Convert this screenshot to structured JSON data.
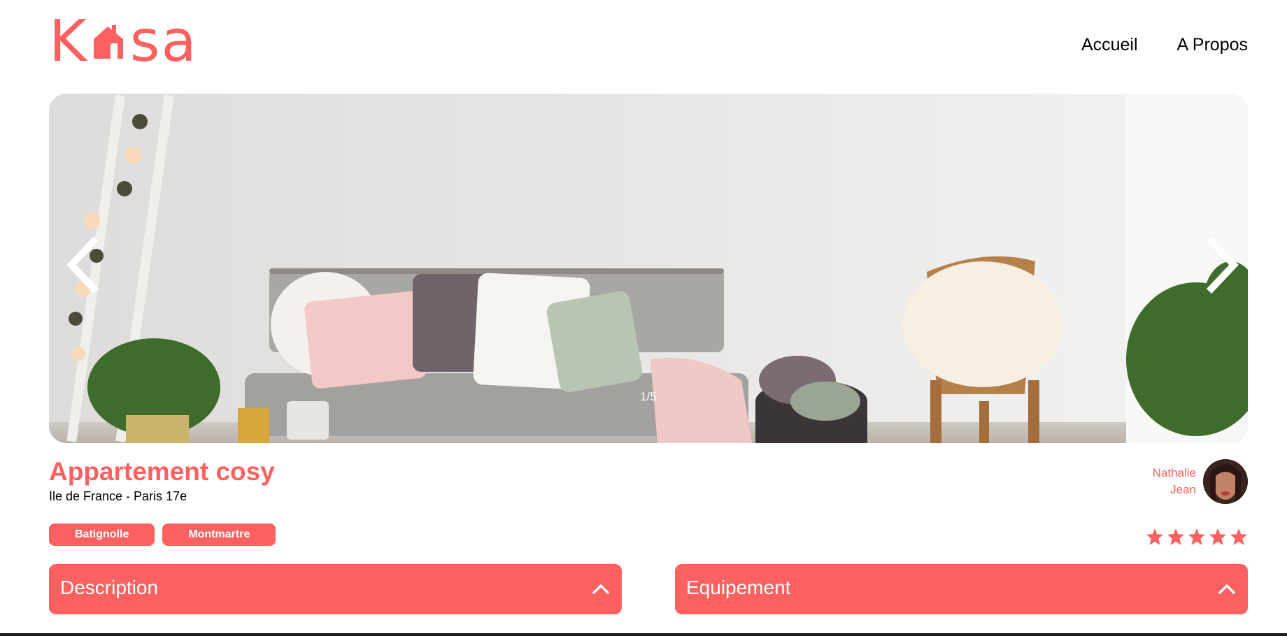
{
  "brand": {
    "logo_left": "K",
    "logo_right": "sa",
    "logo_icon": "house-icon",
    "color": "#FF6060"
  },
  "nav": {
    "items": [
      {
        "label": "Accueil"
      },
      {
        "label": "A Propos"
      }
    ]
  },
  "carousel": {
    "counter": "1/5",
    "prev_icon": "chevron-left-icon",
    "next_icon": "chevron-right-icon"
  },
  "listing": {
    "title": "Appartement cosy",
    "location": "Ile de France - Paris 17e",
    "tags": [
      "Batignolle",
      "Montmartre"
    ],
    "rating": 5,
    "rating_max": 5
  },
  "host": {
    "first_name": "Nathalie",
    "last_name": "Jean"
  },
  "sections": {
    "description": {
      "label": "Description",
      "icon": "chevron-up-icon"
    },
    "equipment": {
      "label": "Equipement",
      "icon": "chevron-up-icon"
    }
  }
}
